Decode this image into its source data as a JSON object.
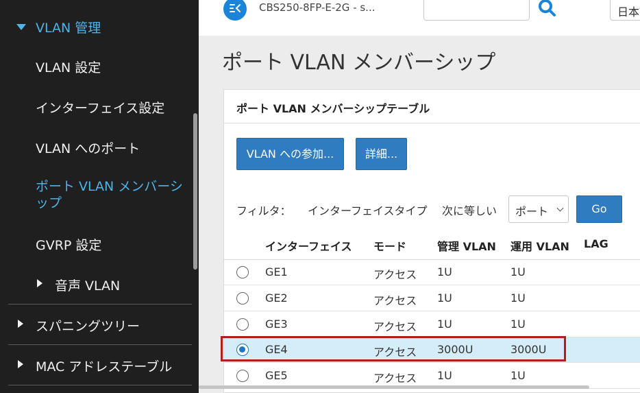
{
  "sidebar": {
    "section_vlan": "VLAN 管理",
    "items": [
      {
        "label": "VLAN 設定"
      },
      {
        "label": "インターフェイス設定"
      },
      {
        "label": "VLAN へのポート"
      },
      {
        "label_line1": "ポート VLAN メンバーシ",
        "label_line2": "ップ"
      },
      {
        "label": "GVRP 設定"
      },
      {
        "label": "音声 VLAN"
      }
    ],
    "section_spanning_tree": "スパニングツリー",
    "section_mac_table": "MAC アドレステーブル",
    "accent_color": "#4fb3e8"
  },
  "topbar": {
    "device_name": "CBS250-8FP-E-2G - s...",
    "search_placeholder": "",
    "language": "日本語",
    "logo_icon": "cisco-business-logo",
    "search_icon": "search-icon"
  },
  "main": {
    "page_title": "ポート VLAN メンバーシップ",
    "panel_title": "ポート VLAN メンバーシップテーブル",
    "buttons": {
      "join_vlan": "VLAN への参加...",
      "details": "詳細..."
    },
    "filter": {
      "label": "フィルタ：",
      "field": "インターフェイスタイプ",
      "condition": "次に等しい",
      "selected": "ポート",
      "go": "Go"
    },
    "table": {
      "headers": [
        "インターフェイス",
        "モード",
        "管理 VLAN",
        "運用 VLAN",
        "LAG"
      ],
      "rows": [
        {
          "interface": "GE1",
          "mode": "アクセス",
          "admin_vlan": "1U",
          "oper_vlan": "1U",
          "lag": "",
          "selected": false
        },
        {
          "interface": "GE2",
          "mode": "アクセス",
          "admin_vlan": "1U",
          "oper_vlan": "1U",
          "lag": "",
          "selected": false
        },
        {
          "interface": "GE3",
          "mode": "アクセス",
          "admin_vlan": "1U",
          "oper_vlan": "1U",
          "lag": "",
          "selected": false
        },
        {
          "interface": "GE4",
          "mode": "アクセス",
          "admin_vlan": "3000U",
          "oper_vlan": "3000U",
          "lag": "",
          "selected": true
        },
        {
          "interface": "GE5",
          "mode": "アクセス",
          "admin_vlan": "1U",
          "oper_vlan": "1U",
          "lag": "",
          "selected": false
        }
      ]
    },
    "accent_color": "#2f7dc0",
    "highlight_color": "#b01e1e"
  }
}
